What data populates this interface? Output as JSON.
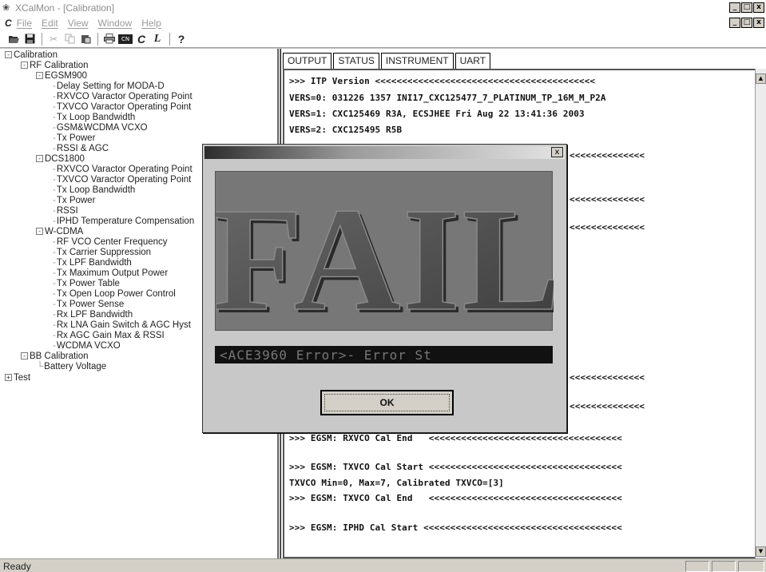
{
  "window": {
    "title": "XCalMon - [Calibration]",
    "app_icon": "calmon-app-icon",
    "controls": [
      "_",
      "□",
      "x"
    ]
  },
  "menu": {
    "items": [
      "File",
      "Edit",
      "View",
      "Window",
      "Help"
    ]
  },
  "toolbar": {
    "buttons": [
      "open-icon",
      "save-icon",
      "cut-icon",
      "copy-icon",
      "paste-icon",
      "print-icon",
      "console-icon",
      "calibrate-icon",
      "log-icon",
      "help-icon"
    ],
    "console_label": "CN",
    "log_label": "L",
    "help_label": "?"
  },
  "tree": {
    "nodes": [
      {
        "label": "Calibration",
        "toggle": "-"
      },
      {
        "label": "RF Calibration",
        "toggle": "-"
      },
      {
        "label": "EGSM900",
        "toggle": "-"
      },
      {
        "label": "Delay Setting for MODA-D"
      },
      {
        "label": "RXVCO Varactor Operating Point"
      },
      {
        "label": "TXVCO Varactor Operating Point"
      },
      {
        "label": "Tx Loop Bandwidth"
      },
      {
        "label": "GSM&WCDMA VCXO"
      },
      {
        "label": "Tx Power"
      },
      {
        "label": "RSSI & AGC"
      },
      {
        "label": "DCS1800",
        "toggle": "-"
      },
      {
        "label": "RXVCO Varactor Operating Point"
      },
      {
        "label": "TXVCO Varactor Operating Point"
      },
      {
        "label": "Tx Loop Bandwidth"
      },
      {
        "label": "Tx Power"
      },
      {
        "label": "RSSI"
      },
      {
        "label": "IPHD Temperature Compensation"
      },
      {
        "label": "W-CDMA",
        "toggle": "-"
      },
      {
        "label": "RF VCO Center Frequency"
      },
      {
        "label": "Tx Carrier Suppression"
      },
      {
        "label": "Tx LPF Bandwidth"
      },
      {
        "label": "Tx Maximum Output Power"
      },
      {
        "label": "Tx Power Table"
      },
      {
        "label": "Tx Open Loop Power Control"
      },
      {
        "label": "Tx Power Sense"
      },
      {
        "label": "Rx LPF Bandwidth"
      },
      {
        "label": "Rx LNA Gain Switch & AGC Hyst"
      },
      {
        "label": "Rx AGC Gain Max & RSSI"
      },
      {
        "label": "WCDMA VCXO"
      },
      {
        "label": "BB Calibration",
        "toggle": "-"
      },
      {
        "label": "Battery Voltage"
      },
      {
        "label": "Test",
        "toggle": "+"
      }
    ]
  },
  "tabs": [
    "OUTPUT",
    "STATUS",
    "INSTRUMENT",
    "UART"
  ],
  "output": {
    "lines": [
      ">>> ITP Version <<<<<<<<<<<<<<<<<<<<<<<<<<<<<<<<<<<<<<<<<",
      "VERS=0: 031226 1357 INI17_CXC125477_7_PLATINUM_TP_16M_M_P2A",
      "VERS=1: CXC125469 R3A, ECSJHEE Fri Aug 22 13:41:36 2003",
      "VERS=2: CXC125495 R5B",
      "<<<<<<<<<<<<<<",
      "<<<<<<<<<<<<<<",
      "<<<<<<<<<<<<<<",
      "<<<<<<<<<<<<<<",
      "<<<<<<<<<<<<<<",
      ">>> EGSM: RXVCO Cal End   <<<<<<<<<<<<<<<<<<<<<<<<<<<<<<<<<<<<",
      ">>> EGSM: TXVCO Cal Start <<<<<<<<<<<<<<<<<<<<<<<<<<<<<<<<<<<<",
      "TXVCO Min=0, Max=7, Calibrated TXVCO=[3]",
      ">>> EGSM: TXVCO Cal End   <<<<<<<<<<<<<<<<<<<<<<<<<<<<<<<<<<<<",
      ">>> EGSM: IPHD Cal Start <<<<<<<<<<<<<<<<<<<<<<<<<<<<<<<<<<<<<"
    ]
  },
  "status": {
    "text": "Ready"
  },
  "dialog": {
    "fail_label": "FAIL",
    "error_message": "<ACE3960 Error>- Error St",
    "ok_label": "OK",
    "close_label": "x"
  },
  "colors": {
    "fail_fill": "#4d4d4d",
    "panel_bg": "#777777"
  }
}
